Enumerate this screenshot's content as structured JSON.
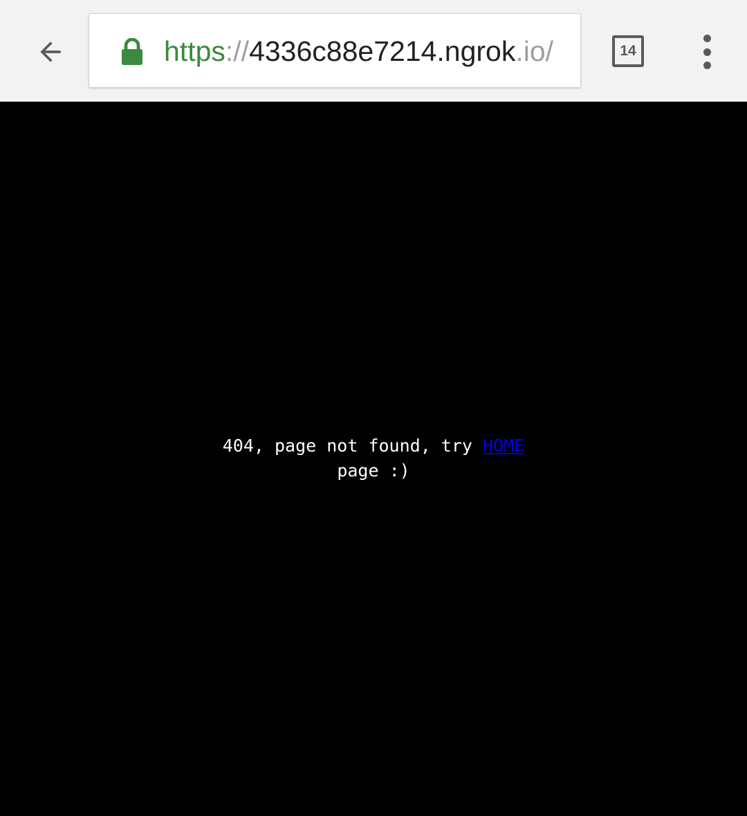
{
  "browser": {
    "back_icon": "arrow-left-icon",
    "lock_icon": "lock-icon",
    "url": {
      "scheme": "https",
      "separator": "://",
      "host": "4336c88e7214.ngrok",
      "tld": ".io/"
    },
    "tab_count": "14",
    "menu_icon": "more-vert-icon",
    "colors": {
      "toolbar": "#f2f2f2",
      "secure_green": "#3b8a3e",
      "icon_gray": "#5a5a5a"
    }
  },
  "page": {
    "background": "#000000",
    "message_line1": "404, page not found, try ",
    "home_link_label": "HOME",
    "message_line2": "page :)",
    "link_color": "#0000ee"
  }
}
